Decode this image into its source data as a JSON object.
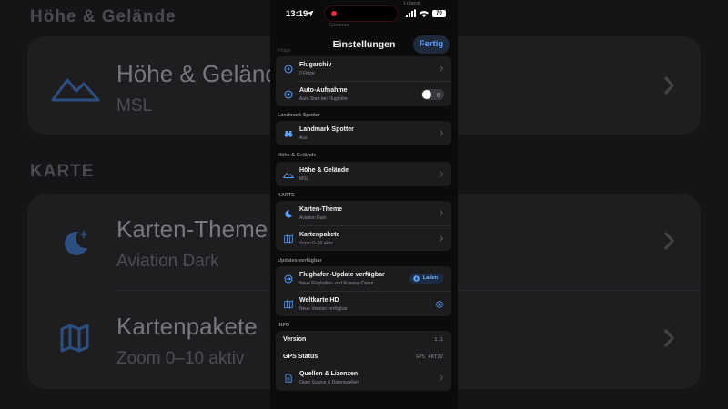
{
  "background": {
    "section_hoehe": "Höhe & Gelände",
    "section_karte": "KARTE",
    "rows": [
      {
        "title": "Höhe & Gelände",
        "subtitle": "MSL"
      },
      {
        "title": "Karten-Theme",
        "subtitle": "Aviation Dark"
      },
      {
        "title": "Kartenpakete",
        "subtitle": "Zoom 0–10 aktiv"
      }
    ]
  },
  "status_bar": {
    "time": "13:19",
    "location_hint": "Lübeck",
    "battery": "70",
    "ghost_text": "Ganzmm"
  },
  "nav": {
    "title": "Einstellungen",
    "done_label": "Fertig"
  },
  "sections": {
    "flug": "Flüge",
    "landmark": "Landmark Spotter",
    "hoehe": "Höhe & Gelände",
    "karte": "KARTE",
    "updates": "Updates verfügbar",
    "info": "INFO"
  },
  "rows": {
    "flugarchiv": {
      "title": "Flugarchiv",
      "subtitle": "0 Flüge"
    },
    "auto_aufnahme": {
      "title": "Auto-Aufnahme",
      "subtitle": "Auto-Start bei Flughöhe",
      "enabled": false
    },
    "landmark_spotter": {
      "title": "Landmark Spotter",
      "subtitle": "Aus"
    },
    "hoehe_gelaende": {
      "title": "Höhe & Gelände",
      "subtitle": "MSL"
    },
    "karten_theme": {
      "title": "Karten-Theme",
      "subtitle": "Aviation Dark"
    },
    "kartenpakete": {
      "title": "Kartenpakete",
      "subtitle": "Zoom 0–10 aktiv"
    },
    "flughafen_update": {
      "title": "Flughafen-Update verfügbar",
      "subtitle": "Neue Flughafen- und Runway-Daten",
      "action": "Laden"
    },
    "weltkarte": {
      "title": "Weltkarte HD",
      "subtitle": "Neue Version verfügbar"
    },
    "version": {
      "label": "Version",
      "value": "1.1"
    },
    "gps": {
      "label": "GPS Status",
      "value": "GPS AKTIV"
    },
    "quellen": {
      "title": "Quellen & Lizenzen",
      "subtitle": "Open Source & Datenquellen"
    }
  },
  "colors": {
    "accent": "#5aa0ff",
    "card": "#1c1c1e",
    "background": "#0b0b0c",
    "recording": "#e0313a"
  },
  "icons": {
    "flugarchiv": "clock-arrow-icon",
    "auto_aufnahme": "record-circle-icon",
    "landmark_spotter": "binoculars-icon",
    "hoehe_gelaende": "mountains-icon",
    "karten_theme": "moon-stars-icon",
    "kartenpakete": "map-icon",
    "flughafen_update": "airplane-circle-icon",
    "weltkarte": "map-icon",
    "quellen": "document-icon"
  }
}
